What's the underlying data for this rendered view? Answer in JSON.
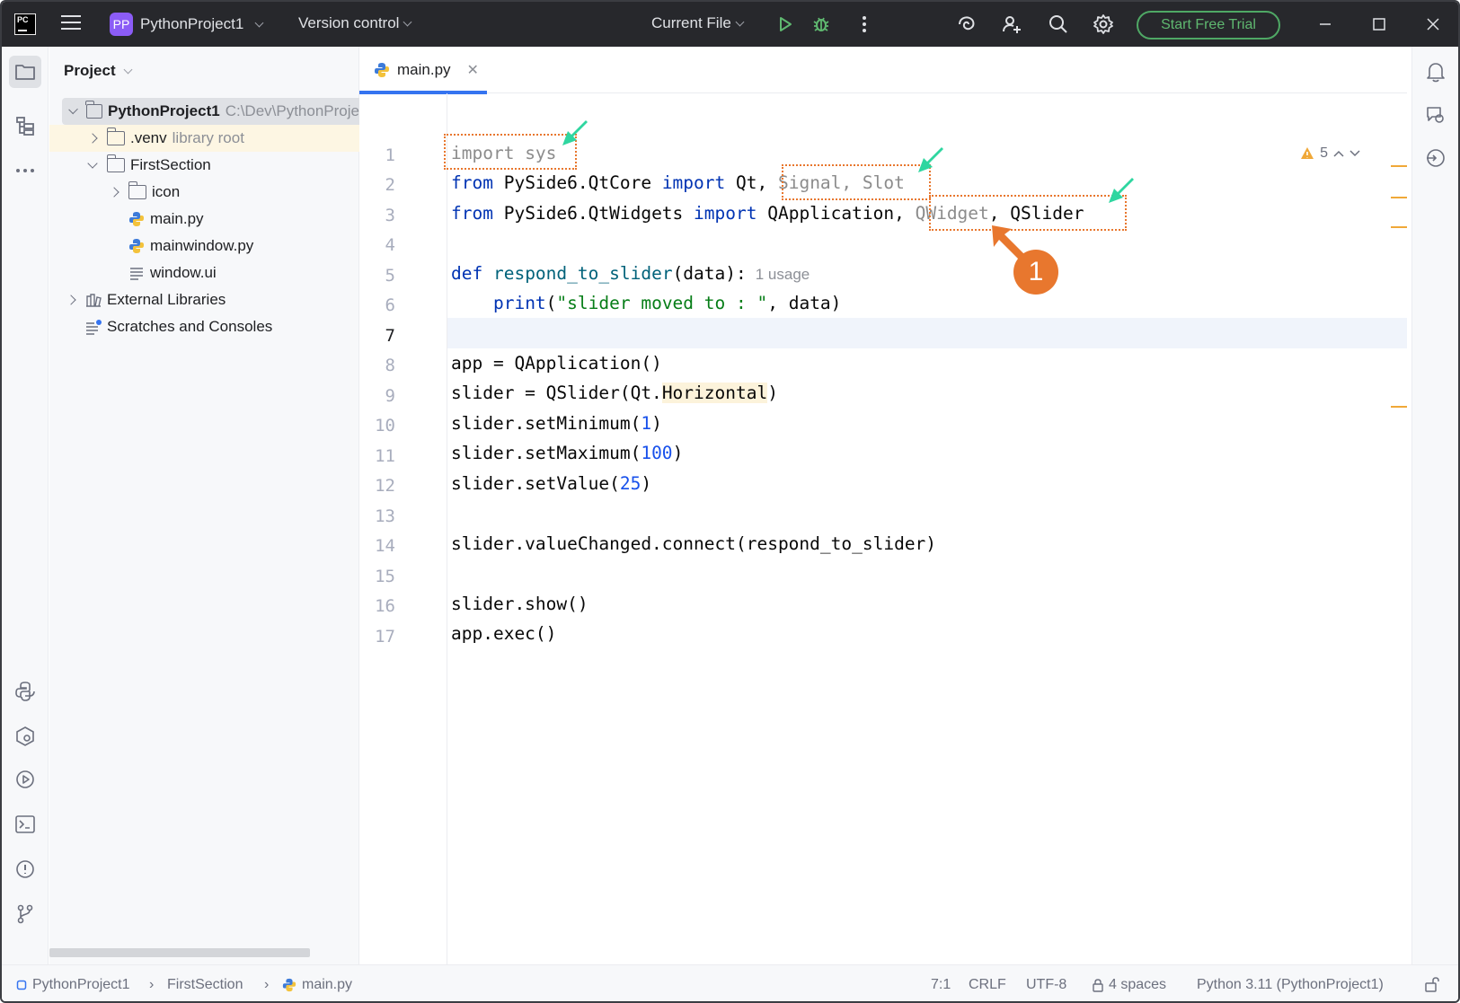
{
  "titlebar": {
    "app_logo": "PC",
    "project_badge": "PP",
    "project_name": "PythonProject1",
    "vcs_label": "Version control",
    "run_config": "Current File",
    "trial_button": "Start Free Trial",
    "accent": "#3574f0"
  },
  "project_panel": {
    "title": "Project",
    "tree": [
      {
        "label": "PythonProject1",
        "hint": "C:\\Dev\\PythonProje"
      },
      {
        "label": ".venv",
        "hint": "library root"
      },
      {
        "label": "FirstSection"
      },
      {
        "label": "icon"
      },
      {
        "label": "main.py"
      },
      {
        "label": "mainwindow.py"
      },
      {
        "label": "window.ui"
      },
      {
        "label": "External Libraries"
      },
      {
        "label": "Scratches and Consoles"
      }
    ]
  },
  "editor": {
    "tab_label": "main.py",
    "line_numbers": [
      "1",
      "2",
      "3",
      "4",
      "5",
      "6",
      "7",
      "8",
      "9",
      "10",
      "11",
      "12",
      "13",
      "14",
      "15",
      "16",
      "17"
    ],
    "usage_hint": "1 usage",
    "warnings_count": "5",
    "callout_number": "1",
    "code": {
      "l1_kw": "import",
      "l1_mod": " sys",
      "l2_from": "from",
      "l2_mod": " PySide6.QtCore ",
      "l2_imp": "import",
      "l2_qt": " Qt,",
      "l2_unused": " Signal, Slot",
      "l3_from": "from",
      "l3_mod": " PySide6.QtWidgets ",
      "l3_imp": "import",
      "l3_app": " QApplication,",
      "l3_unused": " QWidget",
      "l3_rest": ", QSlider",
      "l5_def": "def",
      "l5_fn": " respond_to_slider",
      "l5_rest": "(data):",
      "l6_indent": "    ",
      "l6_print": "print",
      "l6_open": "(",
      "l6_str": "\"slider moved to : \"",
      "l6_rest": ", data)",
      "l8": "app = QApplication()",
      "l9_a": "slider = QSlider(Qt.",
      "l9_b": "Horizontal",
      "l9_c": ")",
      "l10_a": "slider.setMinimum(",
      "l10_n": "1",
      "l10_c": ")",
      "l11_a": "slider.setMaximum(",
      "l11_n": "100",
      "l11_c": ")",
      "l12_a": "slider.setValue(",
      "l12_n": "25",
      "l12_c": ")",
      "l14": "slider.valueChanged.connect(respond_to_slider)",
      "l16": "slider.show()",
      "l17": "app.exec()"
    }
  },
  "statusbar": {
    "crumbs": [
      "PythonProject1",
      "FirstSection",
      "main.py"
    ],
    "position": "7:1",
    "line_sep": "CRLF",
    "encoding": "UTF-8",
    "indent": "4 spaces",
    "interpreter": "Python 3.11 (PythonProject1)"
  }
}
